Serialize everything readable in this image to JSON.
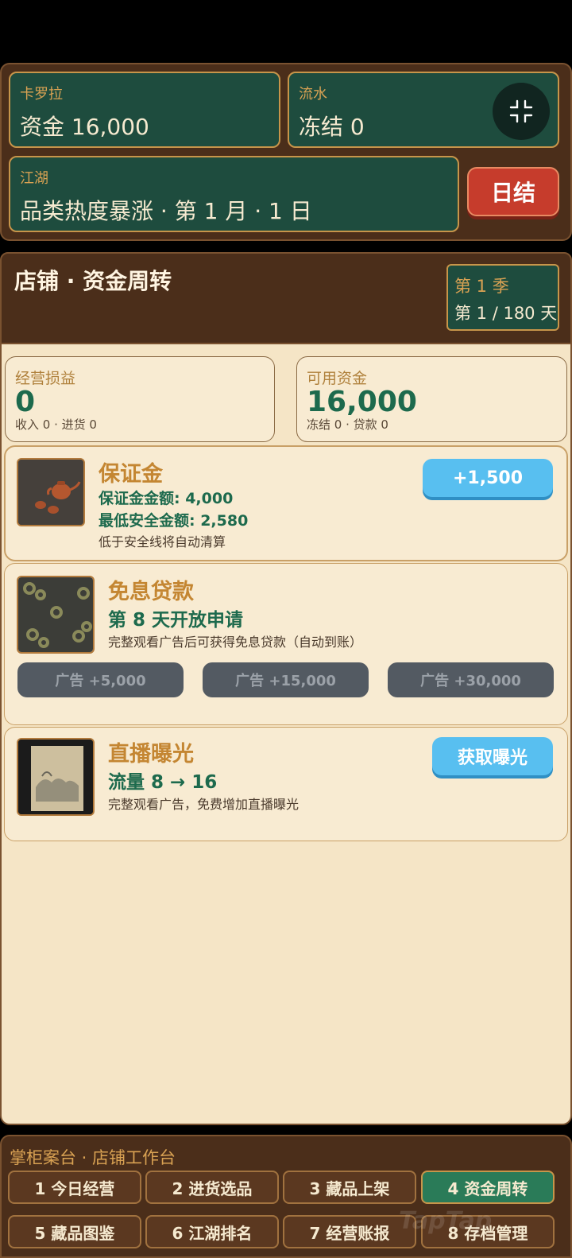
{
  "header": {
    "player_label": "卡罗拉",
    "funds": "资金 16,000",
    "flow_label": "流水",
    "frozen": "冻结 0",
    "jianghu_label": "江湖",
    "event": "品类热度暴涨 · 第 1 月 · 1 日",
    "day_end_button": "日结",
    "minimize_icon": "collapse-icon"
  },
  "shop": {
    "title": "店铺 · 资金周转",
    "season": "第 1 季",
    "day": "第 1 / 180 天"
  },
  "stats": {
    "profit": {
      "label": "经营损益",
      "value": "0",
      "sub": "收入 0 · 进货 0"
    },
    "available": {
      "label": "可用资金",
      "value": "16,000",
      "sub": "冻结 0 · 贷款 0"
    }
  },
  "cards": {
    "deposit": {
      "title": "保证金",
      "line1": "保证金金额: 4,000",
      "line2": "最低安全金额: 2,580",
      "note": "低于安全线将自动清算",
      "button": "+1,500"
    },
    "loan": {
      "title": "免息贷款",
      "line1": "第 8 天开放申请",
      "note": "完整观看广告后可获得免息贷款（自动到账）",
      "buttons": [
        "广告 +5,000",
        "广告 +15,000",
        "广告 +30,000"
      ]
    },
    "live": {
      "title": "直播曝光",
      "line1": "流量 8 → 16",
      "note": "完整观看广告，免费增加直播曝光",
      "button": "获取曝光"
    }
  },
  "nav": {
    "title": "掌柜案台 · 店铺工作台",
    "tabs": [
      "1 今日经营",
      "2 进货选品",
      "3 藏品上架",
      "4 资金周转",
      "5 藏品图鉴",
      "6 江湖排名",
      "7 经营账报",
      "8 存档管理"
    ],
    "active_index": 3
  },
  "watermark": "TapTap",
  "colors": {
    "wood": "#4b2e1a",
    "panel_green": "#1e4c3e",
    "gold": "#d9a253",
    "cream": "#f5e5c6",
    "accent_green": "#1d6a4d",
    "red_button": "#c63c2c",
    "blue_button": "#58bff0"
  }
}
